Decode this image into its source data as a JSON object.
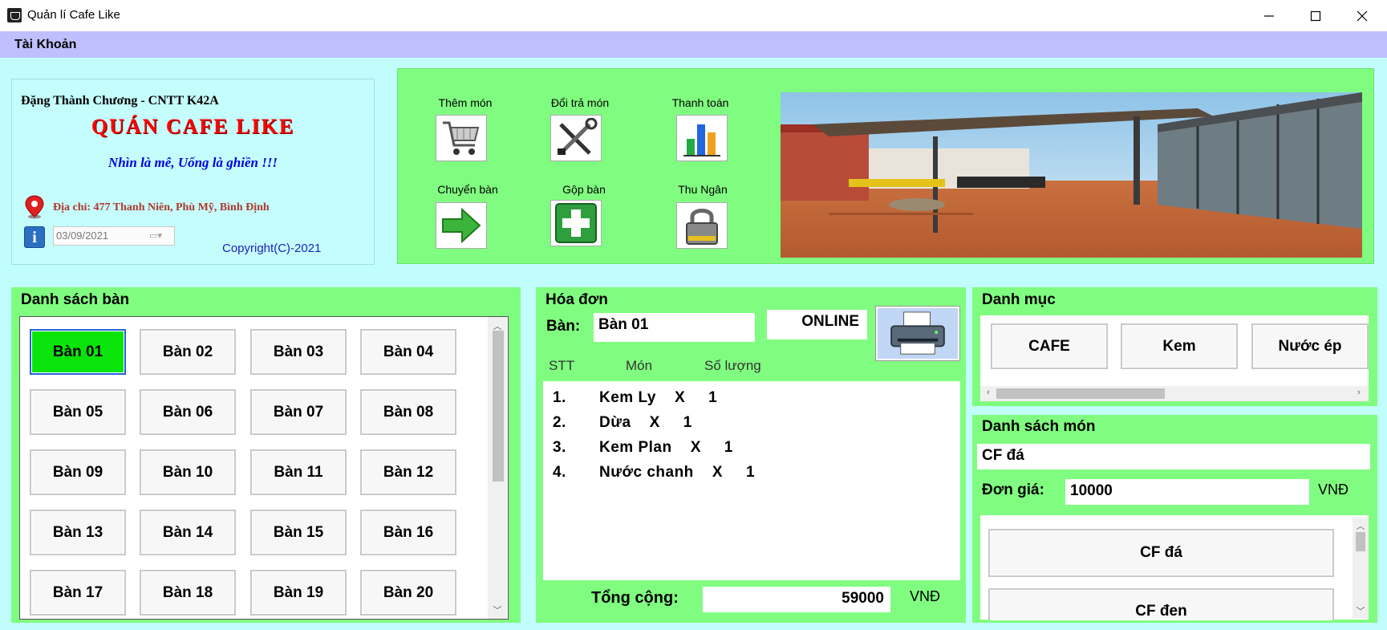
{
  "window": {
    "title": "Quản lí Cafe Like"
  },
  "menu": {
    "account": "Tài Khoản"
  },
  "info": {
    "author": "Đặng Thành Chương - CNTT K42A",
    "shop_name": "QUÁN CAFE LIKE",
    "slogan": "Nhìn là mê, Uống là ghiền !!!",
    "address": "Địa chỉ: 477 Thanh Niên, Phù Mỹ, Bình Định",
    "date": "03/09/2021",
    "copyright": "Copyright(C)-2021"
  },
  "toolbar": {
    "add_item": "Thêm món",
    "return_item": "Đổi trả món",
    "checkout": "Thanh toán",
    "move_table": "Chuyển bàn",
    "merge_table": "Gộp bàn",
    "cashier": "Thu Ngân",
    "icons": [
      "cart-icon",
      "tools-icon",
      "bar-chart-icon",
      "arrow-right-icon",
      "plus-icon",
      "lock-icon"
    ]
  },
  "tables": {
    "title": "Danh sách bàn",
    "selected": "Bàn 01",
    "items": [
      "Bàn 01",
      "Bàn 02",
      "Bàn 03",
      "Bàn 04",
      "Bàn 05",
      "Bàn 06",
      "Bàn 07",
      "Bàn 08",
      "Bàn 09",
      "Bàn 10",
      "Bàn 11",
      "Bàn 12",
      "Bàn 13",
      "Bàn 14",
      "Bàn 15",
      "Bàn 16",
      "Bàn 17",
      "Bàn 18",
      "Bàn 19",
      "Bàn 20"
    ]
  },
  "bill": {
    "title": "Hóa đơn",
    "table_label": "Bàn:",
    "table_value": "Bàn 01",
    "status": "ONLINE",
    "columns": [
      "STT",
      "Món",
      "Số lượng"
    ],
    "items": [
      {
        "no": "1.",
        "text": "Kem Ly    X     1"
      },
      {
        "no": "2.",
        "text": "Dừa    X     1"
      },
      {
        "no": "3.",
        "text": "Kem Plan    X     1"
      },
      {
        "no": "4.",
        "text": "Nước chanh    X     1"
      }
    ],
    "total_label": "Tổng cộng:",
    "total": "59000",
    "currency": "VNĐ"
  },
  "categories": {
    "title": "Danh mục",
    "items": [
      "CAFE",
      "Kem",
      "Nước ép"
    ]
  },
  "dishes": {
    "title": "Danh sách món",
    "selected_name": "CF đá",
    "price_label": "Đơn giá:",
    "price": "10000",
    "currency": "VNĐ",
    "items": [
      "CF đá",
      "CF đen"
    ]
  },
  "colors": {
    "panel_green": "#80fd80",
    "background_cyan": "#c2fdfd",
    "menu_lavender": "#bfbffe",
    "selected_table": "#0be40b",
    "shop_red": "#ff0000"
  }
}
